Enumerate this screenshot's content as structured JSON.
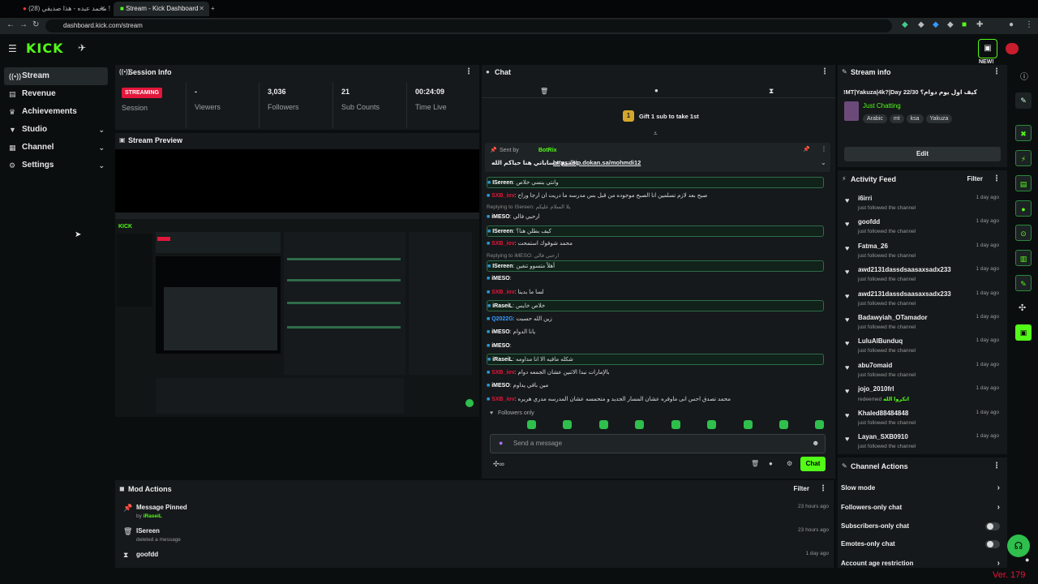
{
  "browser": {
    "tabs": [
      {
        "label": "(28) محمد عبده - هذا صديقي !!"
      },
      {
        "label": "Stream - Kick Dashboard"
      }
    ],
    "new_tab": "+",
    "url": "dashboard.kick.com/stream"
  },
  "app": {
    "logo": "KICK",
    "new_badge": "NEW!",
    "version": "Ver. 179"
  },
  "sidebar": {
    "items": [
      {
        "label": "Stream",
        "active": true
      },
      {
        "label": "Revenue"
      },
      {
        "label": "Achievements"
      },
      {
        "label": "Studio",
        "has_children": true
      },
      {
        "label": "Channel",
        "has_children": true
      },
      {
        "label": "Settings",
        "has_children": true
      }
    ]
  },
  "session": {
    "title": "Session Info",
    "status": "STREAMING",
    "status_label": "Session",
    "viewers": {
      "value": "-",
      "label": "Viewers"
    },
    "followers": {
      "value": "3,036",
      "label": "Followers"
    },
    "subs": {
      "value": "21",
      "label": "Sub Counts"
    },
    "time": {
      "value": "00:24:09",
      "label": "Time Live"
    }
  },
  "preview": {
    "title": "Stream Preview"
  },
  "chat": {
    "title": "Chat",
    "gift_text": "Gift 1 sub to take 1st",
    "gift_count": "1",
    "pinned": {
      "sent_by": "Sent by",
      "author": "BotRix",
      "text": "جميع حساباتي هنا حياكم الله:",
      "link": "https://tip.dokan.sa/mohmdi12"
    },
    "messages": [
      {
        "user": "ISereen",
        "text": "وانتي بنسي خلاص",
        "color": "#ffffff",
        "hl": true
      },
      {
        "user": "SXB_iov",
        "text": "صبح بعد لازم تسلمين انا الصبح موجوده من قبل بس مدرسه ما دريت ان ارجا وراح",
        "color": "#e3163b",
        "hl": false
      },
      {
        "user": "iMESO",
        "text": "ارحبي فالي",
        "color": "#ffffff",
        "hl": false,
        "reply": "Replying to ISereen: يلا السلام عليكم"
      },
      {
        "user": "ISereen",
        "text": "كيف بطلن هنا؟",
        "color": "#ffffff",
        "hl": true
      },
      {
        "user": "SXB_iov",
        "text": "محمد شوفوك استمحت",
        "color": "#e3163b",
        "hl": false
      },
      {
        "user": "ISereen",
        "text": "أهلاً متسوو تنغين",
        "color": "#ffffff",
        "hl": true,
        "reply": "Replying to iMESO: ارحبي فالي"
      },
      {
        "user": "iMESO",
        "text": "",
        "color": "#ffffff",
        "hl": false
      },
      {
        "user": "SXB_iov",
        "text": "لسا ما بدينا",
        "color": "#e3163b",
        "hl": false
      },
      {
        "user": "iRaseiL",
        "text": "خلاص خايس",
        "color": "#ffffff",
        "hl": true
      },
      {
        "user": "Q2022G",
        "text": "زين الله حسبت",
        "color": "#3b9bff",
        "hl": false
      },
      {
        "user": "iMESO",
        "text": "يانا الدوام",
        "color": "#ffffff",
        "hl": false
      },
      {
        "user": "iMESO",
        "text": "",
        "color": "#ffffff",
        "hl": false
      },
      {
        "user": "iRaseiL",
        "text": "شكله مافيه الا انا مداومه",
        "color": "#ffffff",
        "hl": true
      },
      {
        "user": "SXB_iov",
        "text": "بالإمارات نبدا الاثنين عشان الجمعه دوام",
        "color": "#e3163b",
        "hl": false
      },
      {
        "user": "iMESO",
        "text": "مين باقي يداوم",
        "color": "#ffffff",
        "hl": false
      },
      {
        "user": "SXB_iov",
        "text": "محمد تصدق احس انى ماوفره عشان المسار الجديد و متحمسه عشان المدرسه مدري هريره",
        "color": "#e3163b",
        "hl": false
      }
    ],
    "followers_only": "Followers only",
    "input_placeholder": "Send a message",
    "send_label": "Chat"
  },
  "stream_info": {
    "title": "Stream info",
    "stream_title": "!MT|Yakuza|4k?|Day 22/30 كيف اول يوم دوام؟",
    "category": "Just Chatting",
    "tags": [
      "Arabic",
      "mt",
      "ksa",
      "Yakuza"
    ],
    "edit_label": "Edit"
  },
  "activity": {
    "title": "Activity Feed",
    "filter_label": "Filter",
    "items": [
      {
        "name": "i6irri",
        "sub": "just followed the channel",
        "time": "1 day ago"
      },
      {
        "name": "goofdd",
        "sub": "just followed the channel",
        "time": "1 day ago"
      },
      {
        "name": "Fatma_26",
        "sub": "just followed the channel",
        "time": "1 day ago"
      },
      {
        "name": "awd2131dassdsaasaxsadx233",
        "sub": "just followed the channel",
        "time": "1 day ago"
      },
      {
        "name": "awd2131dassdsaasaxsadx233",
        "sub": "just followed the channel",
        "time": "1 day ago"
      },
      {
        "name": "Badawyiah_OTamador",
        "sub": "just followed the channel",
        "time": "1 day ago"
      },
      {
        "name": "LuluAlBunduq",
        "sub": "just followed the channel",
        "time": "1 day ago"
      },
      {
        "name": "abu7omaid",
        "sub": "just followed the channel",
        "time": "1 day ago"
      },
      {
        "name": "jojo_2010frl",
        "sub": "redeemed",
        "reward": "اتكروا الله",
        "time": "1 day ago"
      },
      {
        "name": "Khaled88484848",
        "sub": "just followed the channel",
        "time": "1 day ago"
      },
      {
        "name": "Layan_SXB0910",
        "sub": "just followed the channel",
        "time": "1 day ago"
      }
    ]
  },
  "channel_actions": {
    "title": "Channel Actions",
    "rows": [
      {
        "label": "Slow mode",
        "kind": "arrow"
      },
      {
        "label": "Followers-only chat",
        "kind": "arrow"
      },
      {
        "label": "Subscribers-only chat",
        "kind": "toggle"
      },
      {
        "label": "Emotes-only chat",
        "kind": "toggle"
      },
      {
        "label": "Account age restriction",
        "kind": "arrow"
      }
    ]
  },
  "mod": {
    "title": "Mod Actions",
    "filter_label": "Filter",
    "rows": [
      {
        "title": "Message Pinned",
        "sub": "by",
        "by": "iRaseiL",
        "time": "23 hours ago"
      },
      {
        "title": "ISereen",
        "sub": "deleted a message",
        "time": "23 hours ago"
      },
      {
        "title": "goofdd",
        "sub": "",
        "time": "1 day ago"
      }
    ]
  },
  "colors": {
    "accent": "#53fc18",
    "live": "#e3163b",
    "bg": "#0b0e0f",
    "panel": "#15191b"
  }
}
